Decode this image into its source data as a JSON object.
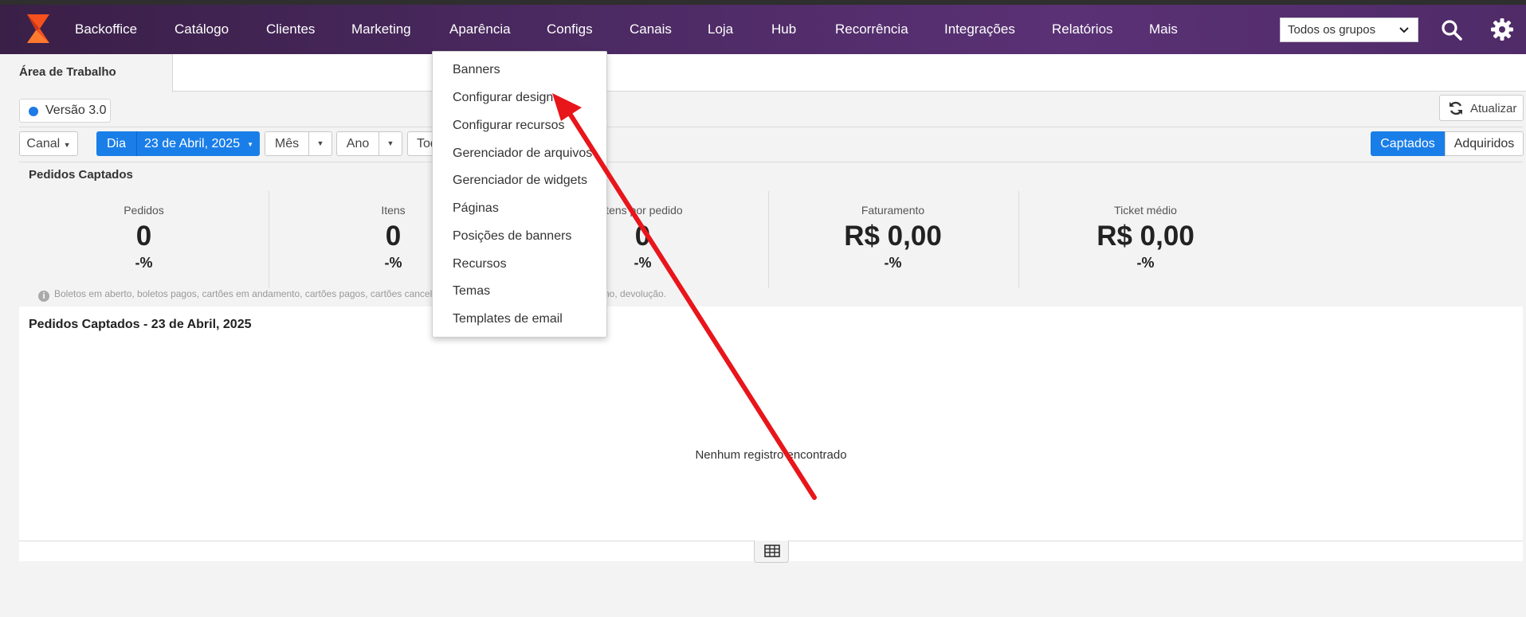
{
  "nav": {
    "items": [
      {
        "label": "Backoffice"
      },
      {
        "label": "Catálogo"
      },
      {
        "label": "Clientes"
      },
      {
        "label": "Marketing"
      },
      {
        "label": "Aparência"
      },
      {
        "label": "Configs"
      },
      {
        "label": "Canais"
      },
      {
        "label": "Loja"
      },
      {
        "label": "Hub"
      },
      {
        "label": "Recorrência"
      },
      {
        "label": "Integrações"
      },
      {
        "label": "Relatórios"
      },
      {
        "label": "Mais"
      }
    ],
    "group_select": "Todos os grupos"
  },
  "tabs": {
    "active": "Área de Trabalho"
  },
  "version": "Versão 3.0",
  "refresh_label": "Atualizar",
  "filters": {
    "canal": "Canal",
    "dia": "Dia",
    "date": "23 de Abril, 2025",
    "mes": "Mês",
    "ano": "Ano",
    "todos_partial": "Tod"
  },
  "toggle": {
    "captados": "Captados",
    "adquiridos": "Adquiridos"
  },
  "section_title": "Pedidos Captados",
  "kpis": [
    {
      "label": "Pedidos",
      "value": "0",
      "pct": "-%"
    },
    {
      "label": "Itens",
      "value": "0",
      "pct": "-%"
    },
    {
      "label": "Itens por pedido",
      "value": "0",
      "pct": "-%"
    },
    {
      "label": "Faturamento",
      "value": "R$ 0,00",
      "pct": "-%"
    },
    {
      "label": "Ticket médio",
      "value": "R$ 0,00",
      "pct": "-%"
    }
  ],
  "note": {
    "left": "Boletos em aberto, boletos pagos, cartões em andamento, cartões pagos, cartões cancelados, bo",
    "right": "no, devolução."
  },
  "panel": {
    "title": "Pedidos Captados - 23 de Abril, 2025",
    "empty": "Nenhum registro encontrado"
  },
  "dropdown": {
    "items": [
      {
        "label": "Banners"
      },
      {
        "label": "Configurar design"
      },
      {
        "label": "Configurar recursos"
      },
      {
        "label": "Gerenciador de arquivos"
      },
      {
        "label": "Gerenciador de widgets"
      },
      {
        "label": "Páginas"
      },
      {
        "label": "Posições de banners"
      },
      {
        "label": "Recursos"
      },
      {
        "label": "Temas"
      },
      {
        "label": "Templates de email"
      }
    ]
  },
  "colors": {
    "nav_bg": "#4a2960",
    "accent_blue": "#1a7ee8",
    "logo_orange": "#f4511e",
    "annotation_red": "#e8151b"
  },
  "icons": {
    "logo": "brand-logo",
    "search": "search-icon",
    "settings": "gear-icon",
    "refresh": "refresh-icon",
    "info": "info-icon",
    "table": "table-icon"
  }
}
